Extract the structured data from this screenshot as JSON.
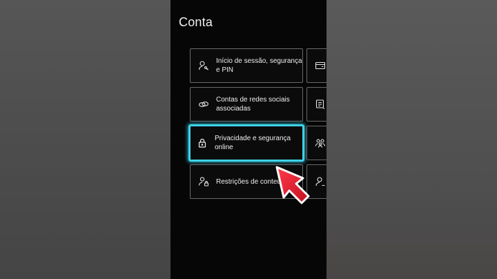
{
  "page": {
    "title": "Conta"
  },
  "tiles": [
    {
      "label": "Início de sessão, segurança e PIN",
      "icon": "person-key-icon"
    },
    {
      "label": "Contas de redes sociais associadas",
      "icon": "linked-rings-icon"
    },
    {
      "label": "Privacidade e segurança online",
      "icon": "lock-icon",
      "focused": true
    },
    {
      "label": "Restrições de conteúdo",
      "icon": "person-lock-icon"
    }
  ],
  "side_tiles": [
    {
      "icon": "wallet-card-icon"
    },
    {
      "icon": "notes-icon"
    },
    {
      "icon": "family-icon"
    },
    {
      "icon": "person-icon"
    }
  ],
  "colors": {
    "focus": "#3ed3ea",
    "arrow": "#e01b2c",
    "background": "#060606"
  }
}
